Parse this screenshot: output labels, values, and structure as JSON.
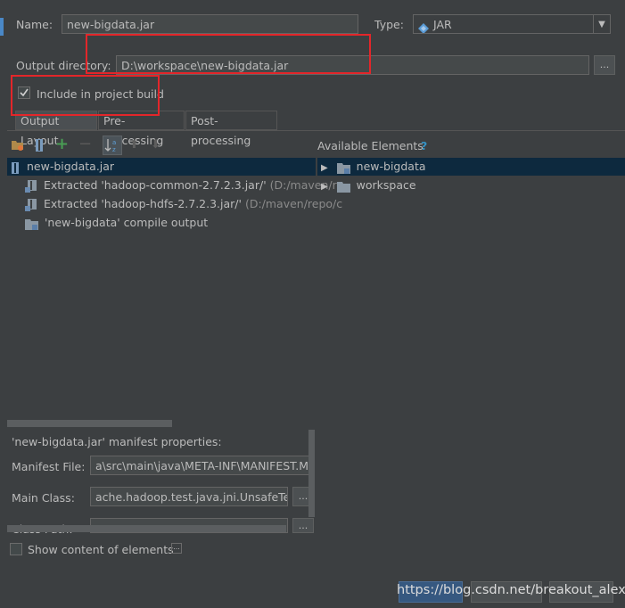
{
  "form": {
    "name_label": "Name:",
    "name_value": "new-bigdata.jar",
    "type_label": "Type:",
    "type_value": "JAR",
    "output_dir_label": "Output directory:",
    "output_dir_value": "D:\\workspace\\new-bigdata.jar",
    "browse_label": "...",
    "include_label": "Include in project build",
    "include_checked": true
  },
  "tabs": [
    {
      "label": "Output Layout",
      "active": true
    },
    {
      "label": "Pre-processing"
    },
    {
      "label": "Post-processing"
    }
  ],
  "output_tree": [
    {
      "label": "new-bigdata.jar",
      "icon": "jar-icon"
    },
    {
      "label": "Extracted 'hadoop-common-2.7.2.3.jar/'",
      "path": "(D:/maven/re",
      "icon": "extracted-archive-icon"
    },
    {
      "label": "Extracted 'hadoop-hdfs-2.7.2.3.jar/'",
      "path": "(D:/maven/repo/c",
      "icon": "extracted-archive-icon"
    },
    {
      "label": "'new-bigdata' compile output",
      "icon": "module-output-folder-icon"
    }
  ],
  "available": {
    "title": "Available Elements",
    "help": "?",
    "items": [
      {
        "label": "new-bigdata",
        "icon": "module-folder-icon"
      },
      {
        "label": "workspace",
        "icon": "folder-icon"
      }
    ]
  },
  "manifest": {
    "header": "'new-bigdata.jar' manifest properties:",
    "file_label": "Manifest File:",
    "file_value": "a\\src\\main\\java\\META-INF\\MANIFEST.MF",
    "main_class_label": "Main Class:",
    "main_class_value": "ache.hadoop.test.java.jni.UnsafeTest",
    "class_path_label": "Class Path:",
    "class_path_value": "",
    "more": "..."
  },
  "show_content_label": "Show content of elements",
  "show_content_checked": false,
  "show_content_more": "...",
  "watermark": "https://blog.csdn.net/breakout_alex",
  "colors": {
    "background": "#3c3f41",
    "panel": "#313335",
    "selection": "#0d293e",
    "annotation": "#e3262a",
    "add_icon": "#499c54",
    "help": "#3592c4"
  }
}
